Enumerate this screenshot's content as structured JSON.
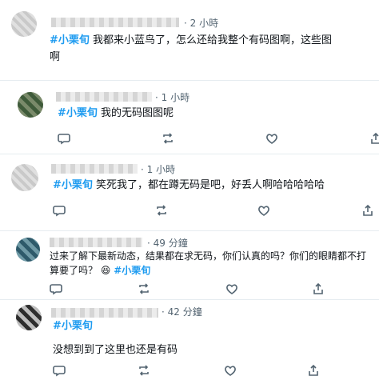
{
  "tweets": [
    {
      "time": "· 2 小時",
      "hashtag": "#小栗旬",
      "text": "我都来小蓝鸟了，怎么还给我整个有码图啊，这些图",
      "text2": "啊"
    },
    {
      "time": "· 1 小時",
      "hashtag": "#小栗旬",
      "text": "我的无码图图呢"
    },
    {
      "time": "· 1 小時",
      "hashtag": "#小栗旬",
      "text": "笑死我了，都在蹲无码是吧，好丢人啊哈哈哈哈哈"
    },
    {
      "time": "· 49 分鐘",
      "text": "过来了解下最新动态，结果都在求无码，你们认真的吗？你们的眼睛都不打",
      "text2a": "算要了吗？",
      "emoji": "😆",
      "hashtag": "#小栗旬"
    },
    {
      "time": "· 42 分鐘",
      "hashtag": "#小栗旬",
      "text": "没想到到了这里也还是有码"
    }
  ],
  "icons": [
    "reply-icon",
    "retweet-icon",
    "like-icon",
    "share-icon"
  ]
}
